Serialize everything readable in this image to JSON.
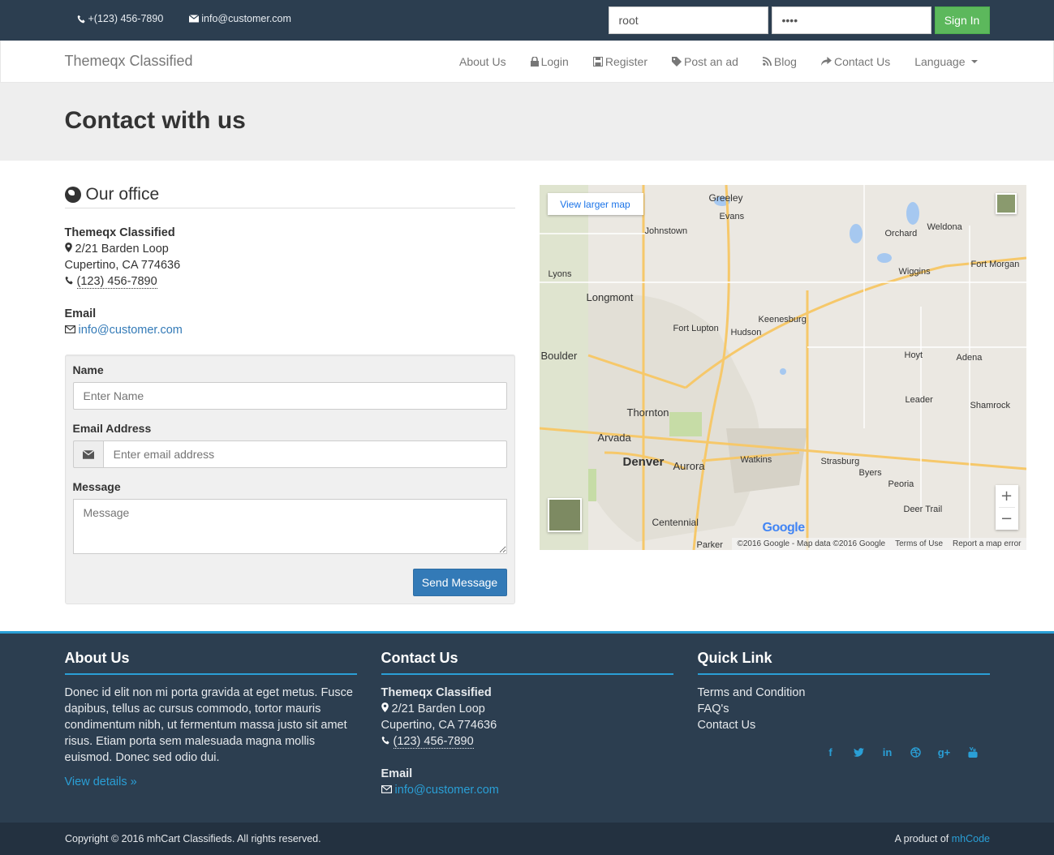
{
  "topbar": {
    "phone": "+(123) 456-7890",
    "email": "info@customer.com",
    "username_value": "root",
    "password_value": "••••",
    "signin_label": "Sign In"
  },
  "navbar": {
    "brand": "Themeqx Classified",
    "items": [
      {
        "label": "About Us",
        "icon": "none"
      },
      {
        "label": "Login",
        "icon": "lock-icon"
      },
      {
        "label": "Register",
        "icon": "save-icon"
      },
      {
        "label": "Post an ad",
        "icon": "tag-icon"
      },
      {
        "label": "Blog",
        "icon": "rss-icon"
      },
      {
        "label": "Contact Us",
        "icon": "share-icon"
      },
      {
        "label": "Language",
        "icon": "caret-down-icon"
      }
    ]
  },
  "page_title": "Contact with us",
  "office": {
    "title": "Our office",
    "company": "Themeqx Classified",
    "street": "2/21 Barden Loop",
    "city": "Cupertino, CA 774636",
    "phone": "(123) 456-7890",
    "email_label": "Email",
    "email": "info@customer.com"
  },
  "form": {
    "name_label": "Name",
    "name_placeholder": "Enter Name",
    "email_label": "Email Address",
    "email_placeholder": "Enter email address",
    "message_label": "Message",
    "message_placeholder": "Message",
    "submit_label": "Send Message"
  },
  "map": {
    "view_larger": "View larger map",
    "zoom_in": "+",
    "zoom_out": "−",
    "google": "Google",
    "copyright": "©2016 Google - Map data ©2016 Google",
    "terms": "Terms of Use",
    "report": "Report a map error",
    "places": [
      "Greeley",
      "Evans",
      "Johnstown",
      "Orchard",
      "Weldona",
      "Fort Morgan",
      "Wiggins",
      "Lyons",
      "Longmont",
      "Keenesburg",
      "Fort Lupton",
      "Hudson",
      "Boulder",
      "Hoyt",
      "Adena",
      "Thornton",
      "Leader",
      "Shamrock",
      "Arvada",
      "Denver",
      "Aurora",
      "Watkins",
      "Strasburg",
      "Byers",
      "Peoria",
      "Deer Trail",
      "Centennial",
      "Parker"
    ]
  },
  "footer": {
    "about_title": "About Us",
    "about_text": "Donec id elit non mi porta gravida at eget metus. Fusce dapibus, tellus ac cursus commodo, tortor mauris condimentum nibh, ut fermentum massa justo sit amet risus. Etiam porta sem malesuada magna mollis euismod. Donec sed odio dui.",
    "about_link": "View details »",
    "contact_title": "Contact Us",
    "company": "Themeqx Classified",
    "street": "2/21 Barden Loop",
    "city": "Cupertino, CA 774636",
    "phone": "(123) 456-7890",
    "email_label": "Email",
    "email": "info@customer.com",
    "quick_title": "Quick Link",
    "quick_links": [
      "Terms and Condition",
      "FAQ's",
      "Contact Us"
    ],
    "social_icons": [
      "facebook-icon",
      "twitter-icon",
      "linkedin-icon",
      "dribbble-icon",
      "google-plus-icon",
      "youtube-icon"
    ]
  },
  "bottom": {
    "copyright": "Copyright © 2016 mhCart Classifieds. All rights reserved.",
    "product_prefix": "A product of ",
    "product_link": "mhCode"
  },
  "colors": {
    "topbar_bg": "#2c3e50",
    "signin_green": "#5cb85c",
    "primary_blue": "#337ab7",
    "footer_accent": "#2a9fd6"
  }
}
